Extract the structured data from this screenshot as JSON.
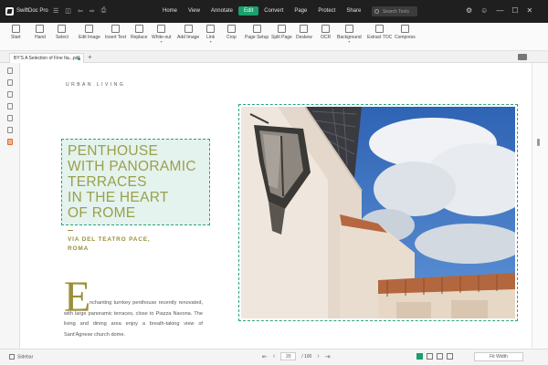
{
  "titlebar": {
    "app_name": "SwiftDoc Pro",
    "quick_icons": [
      "☰",
      "◫",
      "⇦",
      "⇨",
      "⎙"
    ],
    "menu": [
      {
        "label": "Home",
        "active": false
      },
      {
        "label": "View",
        "active": false
      },
      {
        "label": "Annotate",
        "active": false
      },
      {
        "label": "Edit",
        "active": true
      },
      {
        "label": "Convert",
        "active": false
      },
      {
        "label": "Page",
        "active": false
      },
      {
        "label": "Protect",
        "active": false
      },
      {
        "label": "Share",
        "active": false
      },
      {
        "label": "Help",
        "active": false
      }
    ],
    "search_placeholder": "Search Tools",
    "window_icons": [
      "⚙",
      "☺",
      "—",
      "☐",
      "✕"
    ],
    "accent_color": "#1aa16b"
  },
  "ribbon": {
    "tools": [
      {
        "label": "Start",
        "icon": "home-icon"
      },
      {
        "label": "Hand",
        "icon": "hand-icon"
      },
      {
        "label": "Select",
        "icon": "pointer-icon"
      },
      {
        "label": "Edit Image",
        "icon": "edit-image-icon"
      },
      {
        "label": "Insert Text",
        "icon": "insert-text-icon"
      },
      {
        "label": "Replace",
        "icon": "replace-icon"
      },
      {
        "label": "White-out",
        "icon": "whiteout-icon"
      },
      {
        "label": "Add Image",
        "icon": "add-image-icon"
      },
      {
        "label": "Link",
        "icon": "link-icon"
      },
      {
        "label": "Crop",
        "icon": "crop-icon"
      },
      {
        "label": "Page Setup",
        "icon": "page-setup-icon"
      },
      {
        "label": "Split Page",
        "icon": "split-page-icon"
      },
      {
        "label": "Deskew",
        "icon": "deskew-icon"
      },
      {
        "label": "OCR",
        "icon": "ocr-icon"
      },
      {
        "label": "Background",
        "icon": "background-icon"
      },
      {
        "label": "Extract TOC",
        "icon": "extract-toc-icon"
      },
      {
        "label": "Compress",
        "icon": "compress-icon"
      }
    ]
  },
  "tabs": {
    "doc_tab_label": "BY'S A Selection of Fine Ita...pdf",
    "add_tab_symbol": "+"
  },
  "document": {
    "kicker": "URBAN LIVING",
    "headline": "PENTHOUSE\nWITH PANORAMIC\nTERRACES\nIN THE HEART\nOF ROME",
    "subhead": "VIA DEL TEATRO PACE,\nROMA",
    "dropcap": "E",
    "body": "nchanting turnkey penthouse recently renovated, with large panoramic terraces, close to Piazza Navona. The living and dining area enjoy a breath-taking view of Sant'Agnese church dome."
  },
  "statusbar": {
    "sidebar_label": "Sidebar",
    "current_page": "20",
    "total_pages": "/ 100",
    "zoom": "Fit Width"
  }
}
